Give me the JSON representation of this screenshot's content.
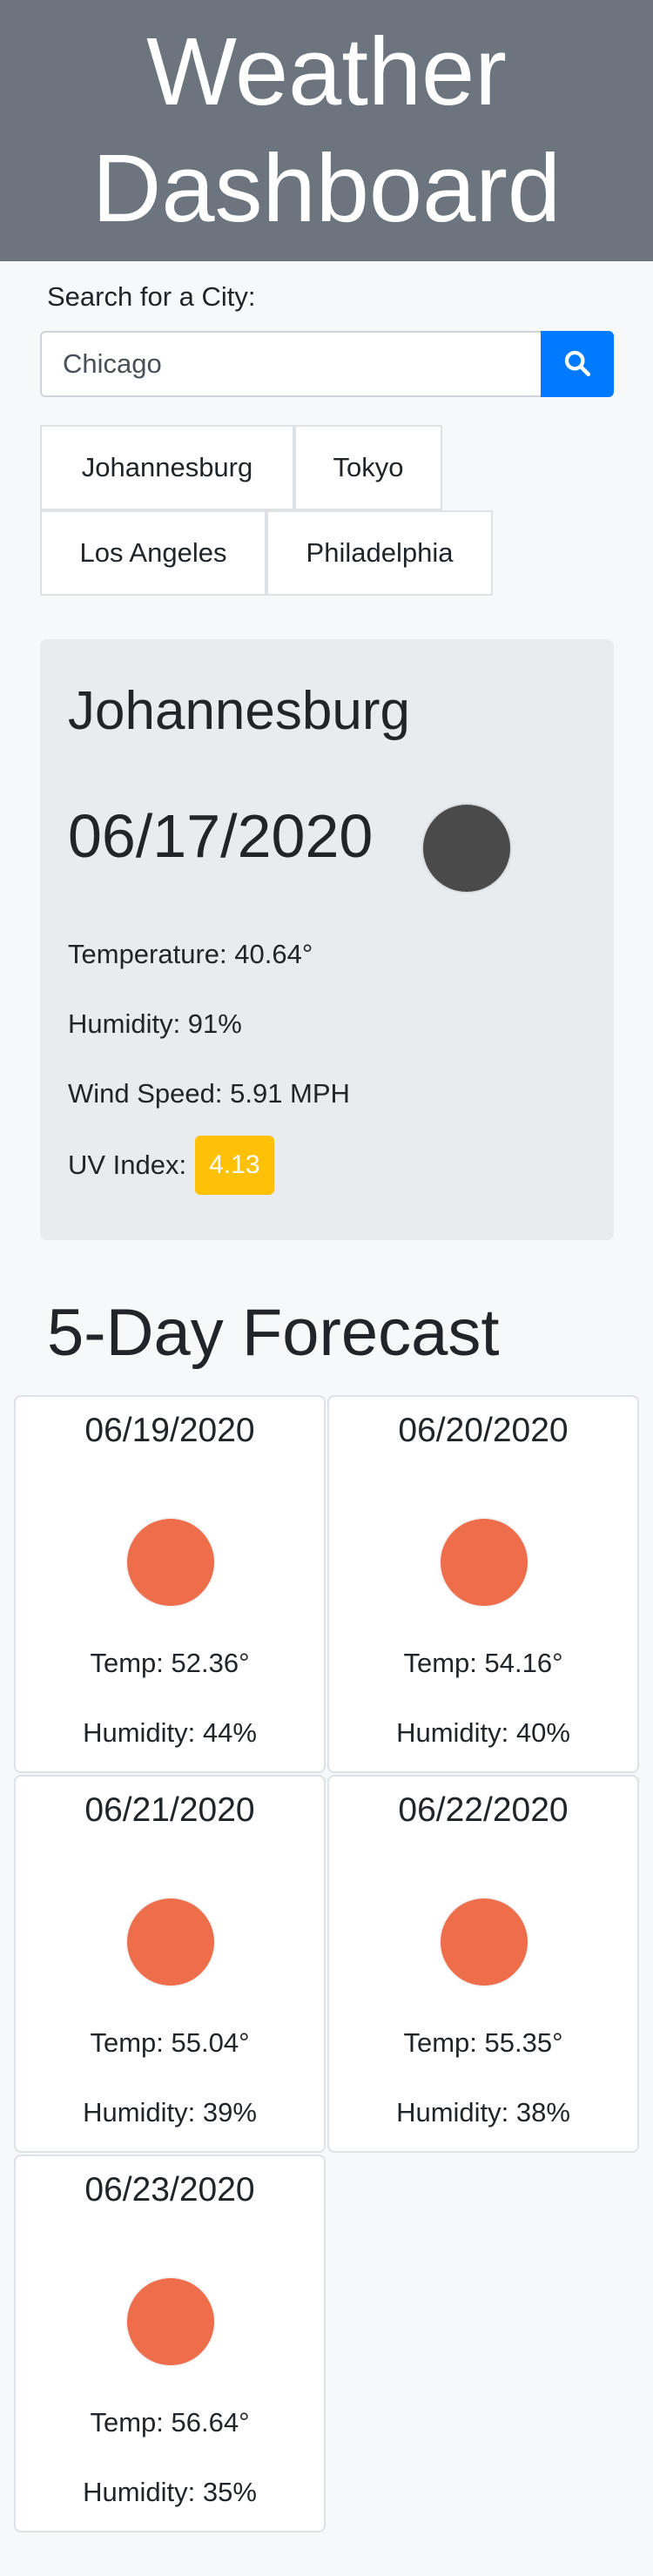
{
  "header": {
    "title": "Weather Dashboard"
  },
  "search": {
    "label": "Search for a City:",
    "value": "Chicago",
    "button_icon": "search-icon"
  },
  "history": [
    {
      "label": "Johannesburg"
    },
    {
      "label": "Tokyo"
    },
    {
      "label": "Los Angeles"
    },
    {
      "label": "Philadelphia"
    }
  ],
  "current": {
    "city": "Johannesburg",
    "date": "06/17/2020",
    "icon": "weather-icon",
    "temperature": "Temperature: 40.64°",
    "humidity": "Humidity: 91%",
    "wind": "Wind Speed: 5.91 MPH",
    "uv_label": "UV Index:",
    "uv_value": "4.13",
    "uv_color": "#ffc107"
  },
  "forecast": {
    "title": "5-Day Forecast",
    "icon_color": "#ee6e4c",
    "days": [
      {
        "date": "06/19/2020",
        "temp": "Temp: 52.36°",
        "humidity": "Humidity: 44%"
      },
      {
        "date": "06/20/2020",
        "temp": "Temp: 54.16°",
        "humidity": "Humidity: 40%"
      },
      {
        "date": "06/21/2020",
        "temp": "Temp: 55.04°",
        "humidity": "Humidity: 39%"
      },
      {
        "date": "06/22/2020",
        "temp": "Temp: 55.35°",
        "humidity": "Humidity: 38%"
      },
      {
        "date": "06/23/2020",
        "temp": "Temp: 56.64°",
        "humidity": "Humidity: 35%"
      }
    ]
  },
  "colors": {
    "header_bg": "#6c757d",
    "accent": "#007bff",
    "card_bg": "#e9ecef"
  }
}
